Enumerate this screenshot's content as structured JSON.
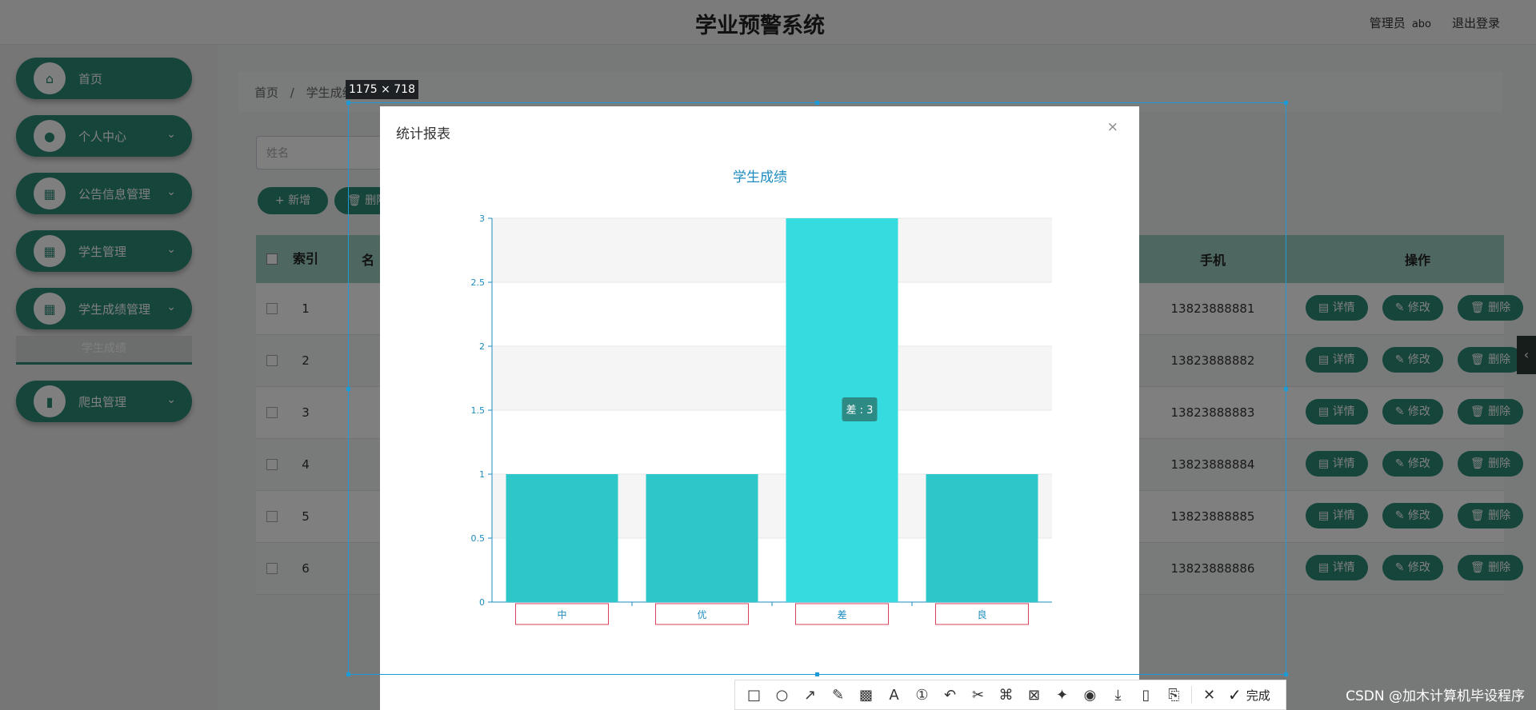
{
  "header": {
    "title": "学业预警系统",
    "user_role": "管理员",
    "username": "abo",
    "logout": "退出登录"
  },
  "sidebar": {
    "items": [
      {
        "label": "首页",
        "icon": "home-icon",
        "glyph": "⌂"
      },
      {
        "label": "个人中心",
        "icon": "person-icon",
        "glyph": "●"
      },
      {
        "label": "公告信息管理",
        "icon": "grid-icon",
        "glyph": "▦"
      },
      {
        "label": "学生管理",
        "icon": "grid-icon",
        "glyph": "▦"
      },
      {
        "label": "学生成绩管理",
        "icon": "grid-icon",
        "glyph": "▦"
      },
      {
        "label": "爬虫管理",
        "icon": "book-icon",
        "glyph": "▮"
      }
    ],
    "submenu": "学生成绩"
  },
  "breadcrumb": {
    "home": "首页",
    "sep": "/",
    "current": "学生成绩"
  },
  "search": {
    "placeholder": "姓名"
  },
  "toolbar_buttons": {
    "add": "+ 新增",
    "delete": "删除"
  },
  "table": {
    "headers": {
      "index": "索引",
      "name": "名",
      "phone": "手机",
      "ops": "操作"
    },
    "rows": [
      {
        "index": "1",
        "phone": "13823888881"
      },
      {
        "index": "2",
        "phone": "13823888882"
      },
      {
        "index": "3",
        "phone": "13823888883"
      },
      {
        "index": "4",
        "phone": "13823888884"
      },
      {
        "index": "5",
        "phone": "13823888885"
      },
      {
        "index": "6",
        "phone": "13823888886"
      }
    ],
    "actions": {
      "detail": "详情",
      "edit": "修改",
      "delete": "删除"
    }
  },
  "selection": {
    "dimensions": "1175 × 718"
  },
  "dialog": {
    "title": "统计报表",
    "close": "×"
  },
  "chart_data": {
    "type": "bar",
    "title": "学生成绩",
    "categories": [
      "中",
      "优",
      "差",
      "良"
    ],
    "values": [
      1,
      1,
      3,
      1
    ],
    "ylim": [
      0,
      3
    ],
    "yticks": [
      "0",
      "0.5",
      "1",
      "1.5",
      "2",
      "2.5",
      "3"
    ],
    "tooltip": "差 : 3",
    "highlighted_index": 2,
    "grid": true,
    "colors": {
      "bar": "#2ec7c9",
      "highlight": "#35dbde",
      "axis": "#1d8cc0",
      "tooltip": "#2d8a85",
      "label_box": "#d9415a"
    }
  },
  "capture_toolbar": {
    "tools": [
      {
        "icon": "rectangle-icon",
        "glyph": "□"
      },
      {
        "icon": "ellipse-icon",
        "glyph": "○"
      },
      {
        "icon": "arrow-icon",
        "glyph": "↗"
      },
      {
        "icon": "pen-icon",
        "glyph": "✎"
      },
      {
        "icon": "mosaic-icon",
        "glyph": "▩"
      },
      {
        "icon": "text-icon",
        "glyph": "A"
      },
      {
        "icon": "number-icon",
        "glyph": "①"
      },
      {
        "icon": "undo-icon",
        "glyph": "↶"
      },
      {
        "icon": "cut-icon",
        "glyph": "✂"
      },
      {
        "icon": "translate-icon",
        "glyph": "⌘"
      },
      {
        "icon": "ocr-icon",
        "glyph": "⊠"
      },
      {
        "icon": "pin-icon",
        "glyph": "✦"
      },
      {
        "icon": "record-icon",
        "glyph": "◉"
      },
      {
        "icon": "download-icon",
        "glyph": "⤓"
      },
      {
        "icon": "phone-icon",
        "glyph": "▯"
      },
      {
        "icon": "bookmark-icon",
        "glyph": "⎘"
      }
    ],
    "cancel_glyph": "✕",
    "done_glyph": "✓",
    "done_label": "完成"
  },
  "watermark": "CSDN @加木计算机毕设程序"
}
